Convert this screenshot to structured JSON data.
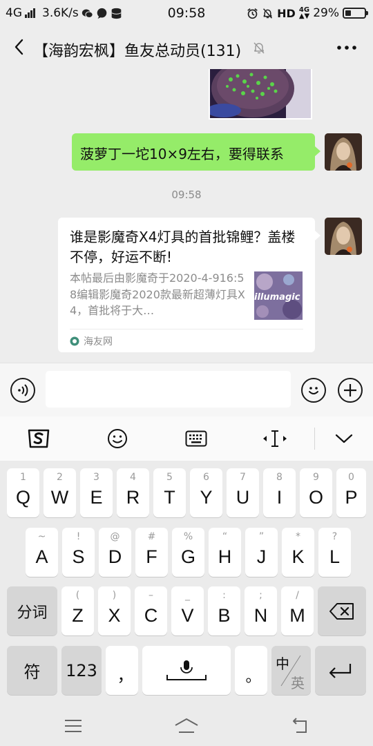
{
  "status_bar": {
    "network": "4G",
    "speed": "3.6K/s",
    "time": "09:58",
    "hd": "HD",
    "net2": "4G",
    "battery_text": "29%",
    "battery_level": 0.29
  },
  "header": {
    "title": "【海韵宏枫】鱼友总动员(131)",
    "back_icon": "chevron-left-icon",
    "mute_icon": "bell-off-icon",
    "more_icon": "more-icon"
  },
  "chat": {
    "messages": [
      {
        "type": "image",
        "from": "other"
      },
      {
        "type": "text",
        "from": "me",
        "text": "菠萝丁一坨10×9左右，要得联系"
      },
      {
        "type": "time",
        "text": "09:58"
      },
      {
        "type": "link",
        "from": "me",
        "title": "谁是影魔奇X4灯具的首批锦鲤？盖楼不停，好运不断!",
        "desc": "本帖最后由影魔奇于2020-4-916:58编辑影魔奇2020款最新超薄灯具X4，首批将于大…",
        "thumb_text": "illumagic",
        "source": "海友网"
      }
    ]
  },
  "input_bar": {
    "value": "",
    "placeholder": "",
    "voice_icon": "voice-icon",
    "emoji_icon": "emoji-icon",
    "add_icon": "plus-icon"
  },
  "keyboard_toolbar": {
    "items": [
      "sogou-logo-icon",
      "emoji-icon",
      "keyboard-icon",
      "cursor-icon",
      "collapse-icon"
    ]
  },
  "keyboard": {
    "row1": [
      {
        "hint": "1",
        "key": "Q"
      },
      {
        "hint": "2",
        "key": "W"
      },
      {
        "hint": "3",
        "key": "E"
      },
      {
        "hint": "4",
        "key": "R"
      },
      {
        "hint": "5",
        "key": "T"
      },
      {
        "hint": "6",
        "key": "Y"
      },
      {
        "hint": "7",
        "key": "U"
      },
      {
        "hint": "8",
        "key": "I"
      },
      {
        "hint": "9",
        "key": "O"
      },
      {
        "hint": "0",
        "key": "P"
      }
    ],
    "row2": [
      {
        "hint": "~",
        "key": "A"
      },
      {
        "hint": "!",
        "key": "S"
      },
      {
        "hint": "@",
        "key": "D"
      },
      {
        "hint": "#",
        "key": "F"
      },
      {
        "hint": "%",
        "key": "G"
      },
      {
        "hint": "“",
        "key": "H"
      },
      {
        "hint": "”",
        "key": "J"
      },
      {
        "hint": "*",
        "key": "K"
      },
      {
        "hint": "?",
        "key": "L"
      }
    ],
    "row3": [
      {
        "hint": "(",
        "key": "Z"
      },
      {
        "hint": ")",
        "key": "X"
      },
      {
        "hint": "–",
        "key": "C"
      },
      {
        "hint": "_",
        "key": "V"
      },
      {
        "hint": ":",
        "key": "B"
      },
      {
        "hint": ";",
        "key": "N"
      },
      {
        "hint": "/",
        "key": "M"
      }
    ],
    "fenci": "分词",
    "symbol": "符",
    "num": "123",
    "comma": "，",
    "period": "。",
    "lang_zh": "中",
    "lang_en": "英"
  },
  "nav_bar": {
    "items": [
      "menu-icon",
      "home-icon",
      "back-icon"
    ]
  }
}
